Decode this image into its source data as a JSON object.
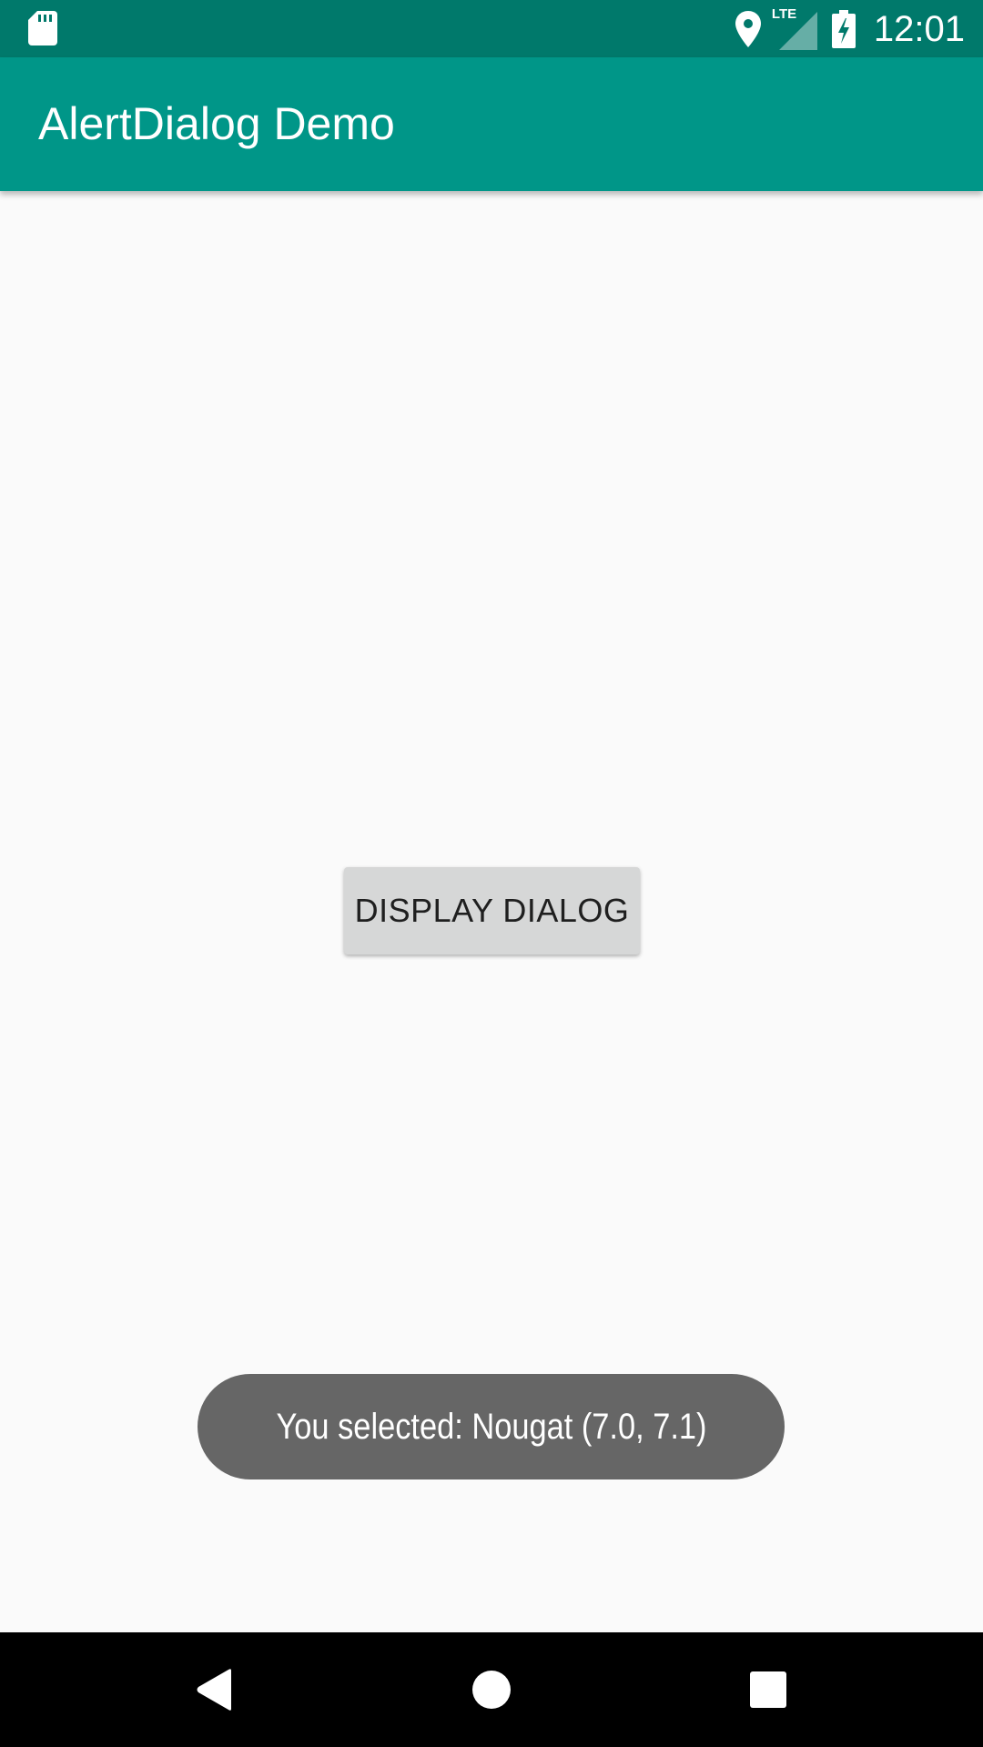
{
  "status_bar": {
    "time": "12:01",
    "network_label": "LTE",
    "icons": [
      "sd-card-icon",
      "location-icon",
      "lte-signal-icon",
      "battery-charging-icon"
    ]
  },
  "app_bar": {
    "title": "AlertDialog Demo"
  },
  "main": {
    "display_dialog_button_label": "DISPLAY DIALOG"
  },
  "toast": {
    "message": "You selected: Nougat (7.0, 7.1)"
  },
  "nav_bar": {
    "buttons": [
      "back-icon",
      "home-icon",
      "recents-icon"
    ]
  },
  "colors": {
    "status_bar": "#00796b",
    "app_bar": "#009688",
    "background": "#fafafa",
    "button": "#d6d7d7",
    "toast": "#666666",
    "nav_bar": "#000000"
  }
}
